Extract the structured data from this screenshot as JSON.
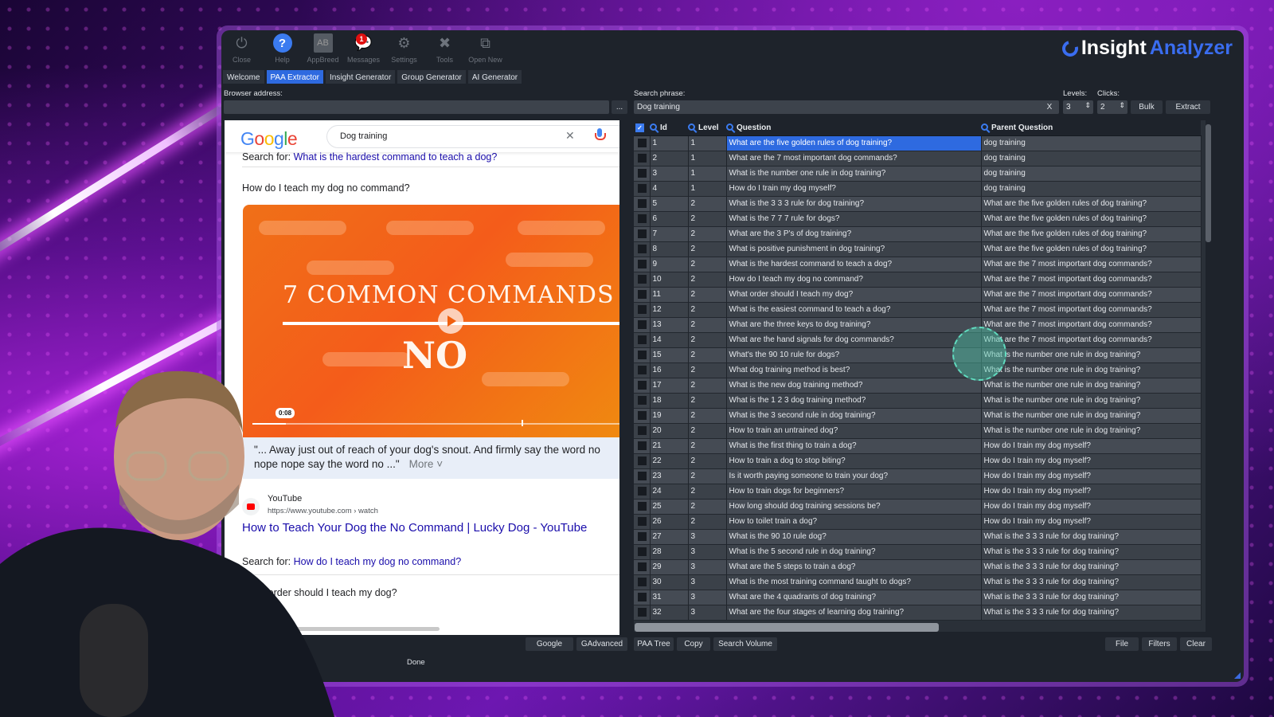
{
  "app": {
    "logo_part1": "Insight",
    "logo_part2": "Analyzer",
    "accent_color": "#2e6ae0"
  },
  "toolbar": [
    {
      "label": "Close",
      "icon": "power-icon"
    },
    {
      "label": "Help",
      "icon": "help-icon"
    },
    {
      "label": "AppBreed",
      "icon": "appbreed-icon"
    },
    {
      "label": "Messages",
      "icon": "messages-icon",
      "badge": "1"
    },
    {
      "label": "Settings",
      "icon": "gear-icon"
    },
    {
      "label": "Tools",
      "icon": "tools-icon"
    },
    {
      "label": "Open New",
      "icon": "open-new-icon"
    }
  ],
  "tabs": [
    {
      "label": "Welcome",
      "active": false
    },
    {
      "label": "PAA Extractor",
      "active": true
    },
    {
      "label": "Insight Generator",
      "active": false
    },
    {
      "label": "Group Generator",
      "active": false
    },
    {
      "label": "AI Generator",
      "active": false
    }
  ],
  "browser": {
    "address_label": "Browser address:",
    "address_value": "",
    "more_button": "...",
    "google_logo": "Google",
    "search_value": "Dog training",
    "search_for_prefix": "Search for:",
    "search_for_link_1": "What is the hardest command to teach a dog?",
    "question_1": "How do I teach my dog no command?",
    "video_title_line1": "7 COMMON COMMANDS",
    "video_title_line2": "NO",
    "video_time": "0:08",
    "video_progress_fraction": 0.09,
    "snippet": "\"... Away just out of reach of your dog's snout. And firmly say the word no nope nope say the word no ...\"",
    "snippet_more": "More",
    "source_name": "YouTube",
    "source_url": "https://www.youtube.com › watch",
    "result_title": "How to Teach Your Dog the No Command | Lucky Dog - YouTube",
    "search_for_link_2": "How do I teach my dog no command?",
    "question_2": "What order should I teach my dog?"
  },
  "search": {
    "phrase_label": "Search phrase:",
    "phrase_value": "Dog training",
    "clear_button": "X",
    "levels_label": "Levels:",
    "levels_value": "3",
    "clicks_label": "Clicks:",
    "clicks_value": "2",
    "bulk_button": "Bulk",
    "extract_button": "Extract"
  },
  "table": {
    "columns": [
      "Id",
      "Level",
      "Question",
      "Parent Question"
    ],
    "selected_row": 1,
    "rows": [
      {
        "id": "1",
        "level": "1",
        "question": "What are the five golden rules of dog training?",
        "parent": "dog training"
      },
      {
        "id": "2",
        "level": "1",
        "question": "What are the 7 most important dog commands?",
        "parent": "dog training"
      },
      {
        "id": "3",
        "level": "1",
        "question": "What is the number one rule in dog training?",
        "parent": "dog training"
      },
      {
        "id": "4",
        "level": "1",
        "question": "How do I train my dog myself?",
        "parent": "dog training"
      },
      {
        "id": "5",
        "level": "2",
        "question": "What is the 3 3 3 rule for dog training?",
        "parent": "What are the five golden rules of dog training?"
      },
      {
        "id": "6",
        "level": "2",
        "question": "What is the 7 7 7 rule for dogs?",
        "parent": "What are the five golden rules of dog training?"
      },
      {
        "id": "7",
        "level": "2",
        "question": "What are the 3 P's of dog training?",
        "parent": "What are the five golden rules of dog training?"
      },
      {
        "id": "8",
        "level": "2",
        "question": "What is positive punishment in dog training?",
        "parent": "What are the five golden rules of dog training?"
      },
      {
        "id": "9",
        "level": "2",
        "question": "What is the hardest command to teach a dog?",
        "parent": "What are the 7 most important dog commands?"
      },
      {
        "id": "10",
        "level": "2",
        "question": "How do I teach my dog no command?",
        "parent": "What are the 7 most important dog commands?"
      },
      {
        "id": "11",
        "level": "2",
        "question": "What order should I teach my dog?",
        "parent": "What are the 7 most important dog commands?"
      },
      {
        "id": "12",
        "level": "2",
        "question": "What is the easiest command to teach a dog?",
        "parent": "What are the 7 most important dog commands?"
      },
      {
        "id": "13",
        "level": "2",
        "question": "What are the three keys to dog training?",
        "parent": "What are the 7 most important dog commands?"
      },
      {
        "id": "14",
        "level": "2",
        "question": "What are the hand signals for dog commands?",
        "parent": "What are the 7 most important dog commands?"
      },
      {
        "id": "15",
        "level": "2",
        "question": "What's the 90 10 rule for dogs?",
        "parent": "What is the number one rule in dog training?"
      },
      {
        "id": "16",
        "level": "2",
        "question": "What dog training method is best?",
        "parent": "What is the number one rule in dog training?"
      },
      {
        "id": "17",
        "level": "2",
        "question": "What is the new dog training method?",
        "parent": "What is the number one rule in dog training?"
      },
      {
        "id": "18",
        "level": "2",
        "question": "What is the 1 2 3 dog training method?",
        "parent": "What is the number one rule in dog training?"
      },
      {
        "id": "19",
        "level": "2",
        "question": "What is the 3 second rule in dog training?",
        "parent": "What is the number one rule in dog training?"
      },
      {
        "id": "20",
        "level": "2",
        "question": "How to train an untrained dog?",
        "parent": "What is the number one rule in dog training?"
      },
      {
        "id": "21",
        "level": "2",
        "question": "What is the first thing to train a dog?",
        "parent": "How do I train my dog myself?"
      },
      {
        "id": "22",
        "level": "2",
        "question": "How to train a dog to stop biting?",
        "parent": "How do I train my dog myself?"
      },
      {
        "id": "23",
        "level": "2",
        "question": "Is it worth paying someone to train your dog?",
        "parent": "How do I train my dog myself?"
      },
      {
        "id": "24",
        "level": "2",
        "question": "How to train dogs for beginners?",
        "parent": "How do I train my dog myself?"
      },
      {
        "id": "25",
        "level": "2",
        "question": "How long should dog training sessions be?",
        "parent": "How do I train my dog myself?"
      },
      {
        "id": "26",
        "level": "2",
        "question": "How to toilet train a dog?",
        "parent": "How do I train my dog myself?"
      },
      {
        "id": "27",
        "level": "3",
        "question": "What is the 90 10 rule dog?",
        "parent": "What is the 3 3 3 rule for dog training?"
      },
      {
        "id": "28",
        "level": "3",
        "question": "What is the 5 second rule in dog training?",
        "parent": "What is the 3 3 3 rule for dog training?"
      },
      {
        "id": "29",
        "level": "3",
        "question": "What are the 5 steps to train a dog?",
        "parent": "What is the 3 3 3 rule for dog training?"
      },
      {
        "id": "30",
        "level": "3",
        "question": "What is the most training command taught to dogs?",
        "parent": "What is the 3 3 3 rule for dog training?"
      },
      {
        "id": "31",
        "level": "3",
        "question": "What are the 4 quadrants of dog training?",
        "parent": "What is the 3 3 3 rule for dog training?"
      },
      {
        "id": "32",
        "level": "3",
        "question": "What are the four stages of learning dog training?",
        "parent": "What is the 3 3 3 rule for dog training?"
      }
    ]
  },
  "bottom": {
    "google_button": "Google",
    "gadvanced_button": "GAdvanced",
    "paa_tree_button": "PAA Tree",
    "copy_button": "Copy",
    "search_volume_button": "Search Volume",
    "file_button": "File",
    "filters_button": "Filters",
    "clear_button": "Clear",
    "status": "Done"
  }
}
